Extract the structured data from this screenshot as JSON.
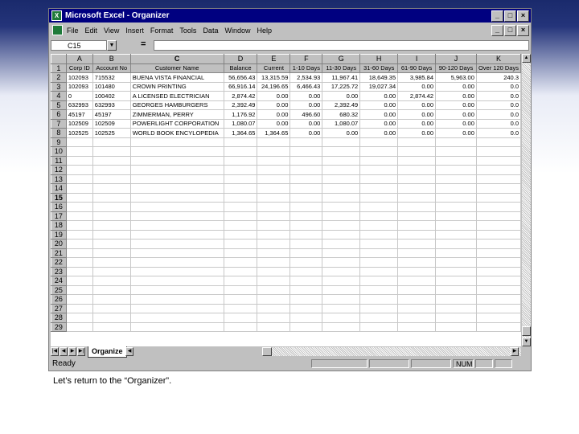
{
  "window": {
    "title": "Microsoft Excel - Organizer"
  },
  "menu": [
    "File",
    "Edit",
    "View",
    "Insert",
    "Format",
    "Tools",
    "Data",
    "Window",
    "Help"
  ],
  "window_buttons": [
    "_",
    "□",
    "×"
  ],
  "formula_bar": {
    "cell_ref": "C15",
    "equals": "=",
    "value": ""
  },
  "sheet": {
    "columns": [
      "A",
      "B",
      "C",
      "D",
      "E",
      "F",
      "G",
      "H",
      "I",
      "J",
      "K"
    ],
    "headers": [
      "Corp ID",
      "Account No",
      "Customer Name",
      "Balance",
      "Current",
      "1-10 Days",
      "11-30 Days",
      "31-60 Days",
      "61-90 Days",
      "90-120 Days",
      "Over 120 Days"
    ],
    "rows": [
      [
        "102093",
        "715532",
        "BUENA VISTA FINANCIAL",
        "56,656.43",
        "13,315.59",
        "2,534.93",
        "11,967.41",
        "18,649.35",
        "3,985.84",
        "5,963.00",
        "240.3"
      ],
      [
        "102093",
        "101480",
        "CROWN PRINTING",
        "66,916.14",
        "24,196.65",
        "6,466.43",
        "17,225.72",
        "19,027.34",
        "0.00",
        "0.00",
        "0.0"
      ],
      [
        "0",
        "100402",
        "A LICENSED ELECTRICIAN",
        "2,874.42",
        "0.00",
        "0.00",
        "0.00",
        "0.00",
        "2,874.42",
        "0.00",
        "0.0"
      ],
      [
        "632993",
        "632993",
        "GEORGES HAMBURGERS",
        "2,392.49",
        "0.00",
        "0.00",
        "2,392.49",
        "0.00",
        "0.00",
        "0.00",
        "0.0"
      ],
      [
        "45197",
        "45197",
        "ZIMMERMAN, PERRY",
        "1,176.92",
        "0.00",
        "496.60",
        "680.32",
        "0.00",
        "0.00",
        "0.00",
        "0.0"
      ],
      [
        "102509",
        "102509",
        "POWERLIGHT CORPORATION",
        "1,080.07",
        "0.00",
        "0.00",
        "1,080.07",
        "0.00",
        "0.00",
        "0.00",
        "0.0"
      ],
      [
        "102525",
        "102525",
        "WORLD BOOK ENCYLOPEDIA",
        "1,364.65",
        "1,364.65",
        "0.00",
        "0.00",
        "0.00",
        "0.00",
        "0.00",
        "0.0"
      ]
    ],
    "active_row": "15",
    "active_col": "C",
    "tab_name": "Organize"
  },
  "status": {
    "ready": "Ready",
    "num": "NUM"
  },
  "caption": "Let’s return to the “Organizer”."
}
